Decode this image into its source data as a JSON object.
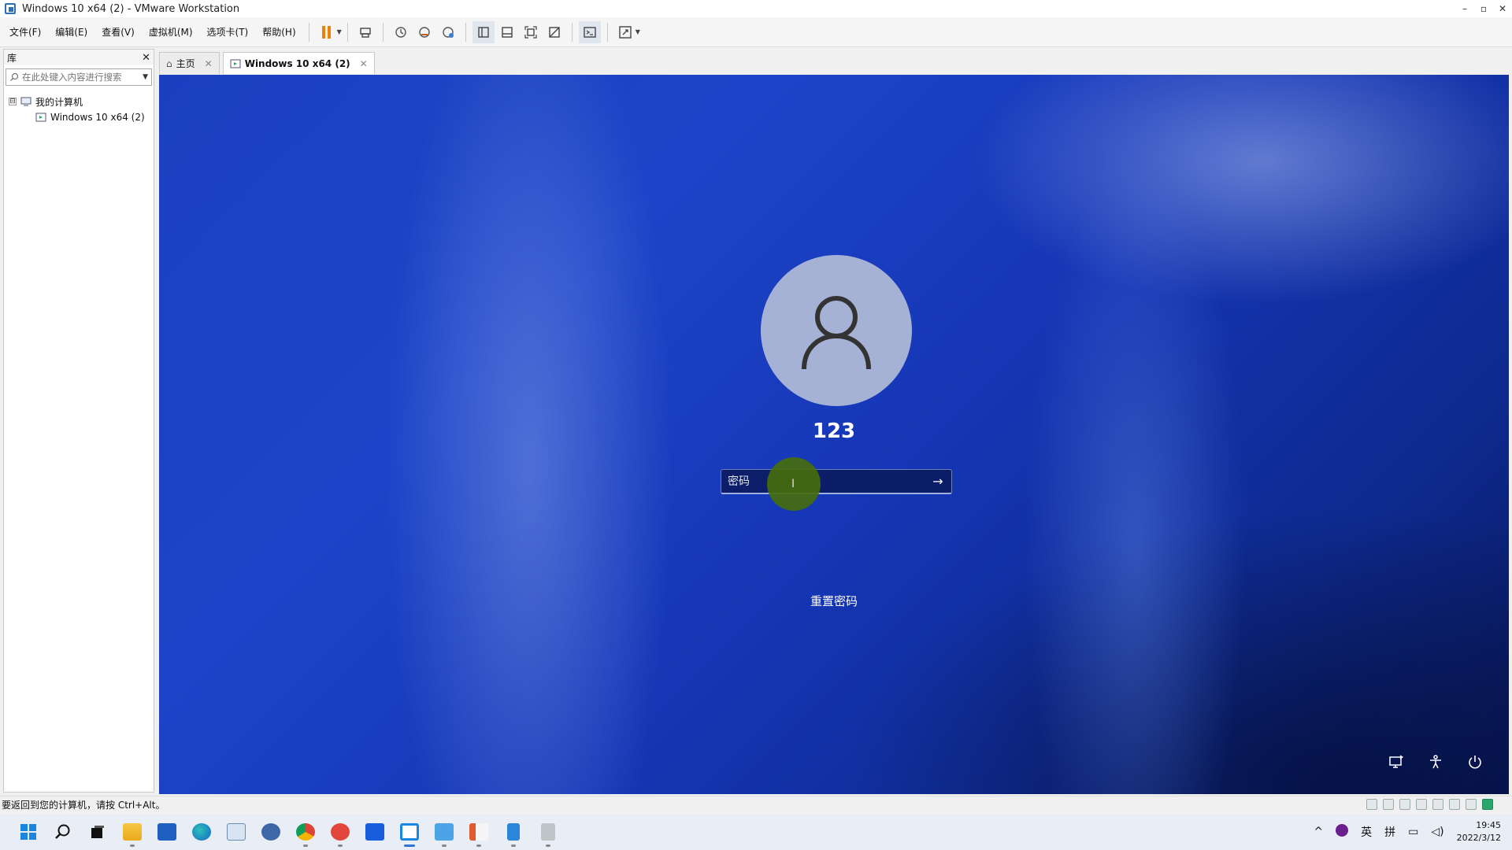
{
  "window": {
    "title": "Windows 10 x64 (2) - VMware Workstation",
    "minimize": "–",
    "restore": "▫",
    "close": "✕"
  },
  "menu": [
    "文件(F)",
    "编辑(E)",
    "查看(V)",
    "虚拟机(M)",
    "选项卡(T)",
    "帮助(H)"
  ],
  "toolbar": {
    "icons": [
      "pause-icon",
      "send-ctrl-alt-del-icon",
      "snapshot-icon",
      "revert-snapshot-icon",
      "snapshot-manager-icon",
      "library-view-icon",
      "thumbnail-view-icon",
      "fullscreen-icon",
      "unity-icon",
      "console-icon",
      "stretch-icon"
    ]
  },
  "library": {
    "title": "库",
    "close": "✕",
    "search_placeholder": "在此处键入内容进行搜索",
    "tree": {
      "root": "我的计算机",
      "expander": "⊟",
      "children": [
        "Windows 10 x64 (2)"
      ]
    }
  },
  "tabs": [
    {
      "label": "主页",
      "icon": "home-icon"
    },
    {
      "label": "Windows 10 x64 (2)",
      "icon": "vm-icon",
      "active": true
    }
  ],
  "vm": {
    "user_name": "123",
    "password_placeholder": "密码",
    "submit_glyph": "→",
    "reset_link": "重置密码",
    "bottom_icons": [
      "network-icon",
      "accessibility-icon",
      "power-icon"
    ]
  },
  "status": {
    "message": "要返回到您的计算机，请按 Ctrl+Alt。"
  },
  "taskbar": {
    "apps": [
      "start-icon",
      "search-icon",
      "task-view-icon",
      "file-explorer-icon",
      "store-icon",
      "edge-icon",
      "photos-icon",
      "network-app-icon",
      "chrome-icon",
      "app-red-icon",
      "bitwarden-icon",
      "vmware-icon",
      "remote-desktop-icon",
      "office-icon",
      "notepad-icon",
      "archive-icon"
    ],
    "tray": {
      "chevron": "^",
      "lang1": "英",
      "lang2": "拼",
      "time": "19:45",
      "date": "2022/3/12"
    }
  },
  "colors": {
    "accent": "#2b77d4",
    "vm_bg": "#1d44c8",
    "avatar_bg": "#a5b2d5"
  }
}
